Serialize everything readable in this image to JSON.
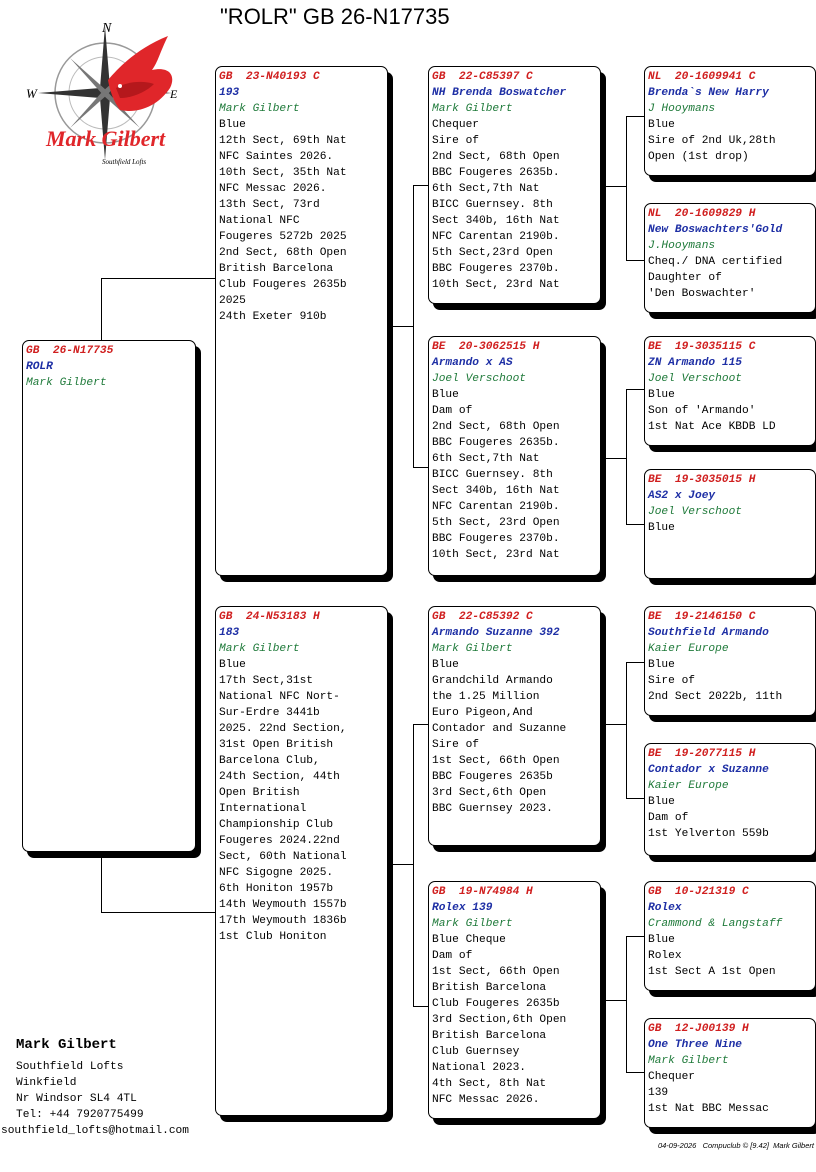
{
  "header": {
    "title": "\"ROLR\"  GB  26-N17735"
  },
  "logo": {
    "name_text": "Mark Gilbert",
    "sub_text": "Southfield Lofts",
    "compass_n": "N",
    "compass_w": "W",
    "compass_e": "E",
    "accent": "#e0262a"
  },
  "subject": {
    "ring": "GB  26-N17735",
    "name": "ROLR",
    "breeder": "Mark Gilbert",
    "lines": []
  },
  "sire": {
    "ring": "GB  23-N40193 C",
    "name": "193",
    "breeder": "Mark Gilbert",
    "lines": [
      "Blue",
      "12th Sect, 69th Nat",
      "NFC Saintes 2026.",
      "10th Sect, 35th Nat",
      "NFC Messac 2026.",
      "13th Sect, 73rd",
      "National NFC",
      "Fougeres 5272b 2025",
      "",
      "2nd Sect, 68th Open",
      "British Barcelona",
      "Club Fougeres 2635b",
      "2025",
      "",
      "24th Exeter 910b"
    ]
  },
  "dam": {
    "ring": "GB  24-N53183 H",
    "name": "183",
    "breeder": "Mark Gilbert",
    "lines": [
      "Blue",
      "17th Sect,31st",
      "National NFC Nort-",
      "Sur-Erdre 3441b",
      "2025. 22nd Section,",
      "31st Open British",
      "Barcelona Club,",
      "24th Section, 44th",
      "Open British",
      "International",
      "Championship Club",
      "Fougeres 2024.22nd",
      "Sect, 60th National",
      "NFC Sigogne 2025.",
      "6th Honiton 1957b",
      "14th Weymouth 1557b",
      "17th Weymouth 1836b",
      "",
      "1st Club Honiton"
    ]
  },
  "ss": {
    "ring": "GB  22-C85397 C",
    "name": "NH Brenda Boswatcher",
    "breeder": "Mark Gilbert",
    "lines": [
      "Chequer",
      "Sire of",
      "2nd Sect, 68th Open",
      "BBC Fougeres 2635b.",
      "6th Sect,7th Nat",
      "BICC Guernsey. 8th",
      "Sect 340b, 16th Nat",
      "NFC Carentan 2190b.",
      "5th Sect,23rd Open",
      "BBC Fougeres 2370b.",
      "10th Sect, 23rd Nat"
    ]
  },
  "sd": {
    "ring": "BE  20-3062515 H",
    "name": "Armando x AS",
    "breeder": "Joel Verschoot",
    "lines": [
      "Blue",
      "Dam of",
      "2nd Sect, 68th Open",
      "BBC Fougeres 2635b.",
      "6th Sect,7th Nat",
      "BICC Guernsey. 8th",
      "Sect 340b, 16th Nat",
      "NFC Carentan 2190b.",
      "5th Sect, 23rd Open",
      "BBC Fougeres 2370b.",
      "10th Sect, 23rd Nat"
    ]
  },
  "ds": {
    "ring": "GB  22-C85392 C",
    "name": "Armando Suzanne 392",
    "breeder": "Mark Gilbert",
    "lines": [
      "Blue",
      "Grandchild Armando",
      "the 1.25 Million",
      "Euro Pigeon,And",
      "Contador and Suzanne",
      "",
      "Sire of",
      "1st Sect, 66th Open",
      "BBC Fougeres 2635b",
      "3rd Sect,6th Open",
      "BBC Guernsey 2023."
    ]
  },
  "dd": {
    "ring": "GB  19-N74984 H",
    "name": "Rolex 139",
    "breeder": "Mark Gilbert",
    "lines": [
      "Blue Cheque",
      "Dam of",
      "1st Sect, 66th Open",
      "British Barcelona",
      "Club Fougeres 2635b",
      "3rd Section,6th Open",
      "British Barcelona",
      "Club Guernsey",
      "National 2023.",
      "4th Sect, 8th Nat",
      "NFC Messac 2026."
    ]
  },
  "sss": {
    "ring": "NL  20-1609941 C",
    "name": "Brenda`s New Harry",
    "breeder": "J Hooymans",
    "lines": [
      "Blue",
      "Sire of 2nd Uk,28th",
      "Open (1st drop)"
    ]
  },
  "ssd": {
    "ring": "NL  20-1609829 H",
    "name": "New Boswachters'Gold",
    "breeder": "J.Hooymans",
    "lines": [
      "Cheq./ DNA certified",
      "Daughter of",
      "'Den Boswachter'"
    ]
  },
  "sds": {
    "ring": "BE  19-3035115 C",
    "name": "ZN Armando 115",
    "breeder": "Joel Verschoot",
    "lines": [
      "Blue",
      "Son of 'Armando'",
      "1st Nat Ace KBDB LD"
    ]
  },
  "sdd": {
    "ring": "BE  19-3035015 H",
    "name": "AS2 x Joey",
    "breeder": "Joel Verschoot",
    "lines": [
      "Blue"
    ]
  },
  "dss": {
    "ring": "BE  19-2146150 C",
    "name": "Southfield Armando",
    "breeder": "Kaier Europe",
    "lines": [
      "Blue",
      "Sire of",
      "2nd Sect 2022b, 11th"
    ]
  },
  "dsd": {
    "ring": "BE  19-2077115 H",
    "name": "Contador x Suzanne",
    "breeder": "Kaier Europe",
    "lines": [
      "Blue",
      "Dam of",
      "1st Yelverton 559b"
    ]
  },
  "dds": {
    "ring": "GB  10-J21319 C",
    "name": "Rolex",
    "breeder": "Crammond & Langstaff",
    "lines": [
      "Blue",
      "Rolex",
      "1st Sect A 1st Open"
    ]
  },
  "ddd": {
    "ring": "GB  12-J00139 H",
    "name": "One Three Nine",
    "breeder": "Mark Gilbert",
    "lines": [
      "Chequer",
      "139",
      "1st Nat BBC Messac"
    ]
  },
  "owner": {
    "name": "Mark Gilbert",
    "lines": [
      "Southfield Lofts",
      "Winkfield",
      "Nr Windsor SL4 4TL",
      "Tel: +44 7920775499"
    ],
    "email": "southfield_lofts@hotmail.com"
  },
  "credit": "04-09-2026   Compuclub © [9.42]  Mark Gilbert"
}
